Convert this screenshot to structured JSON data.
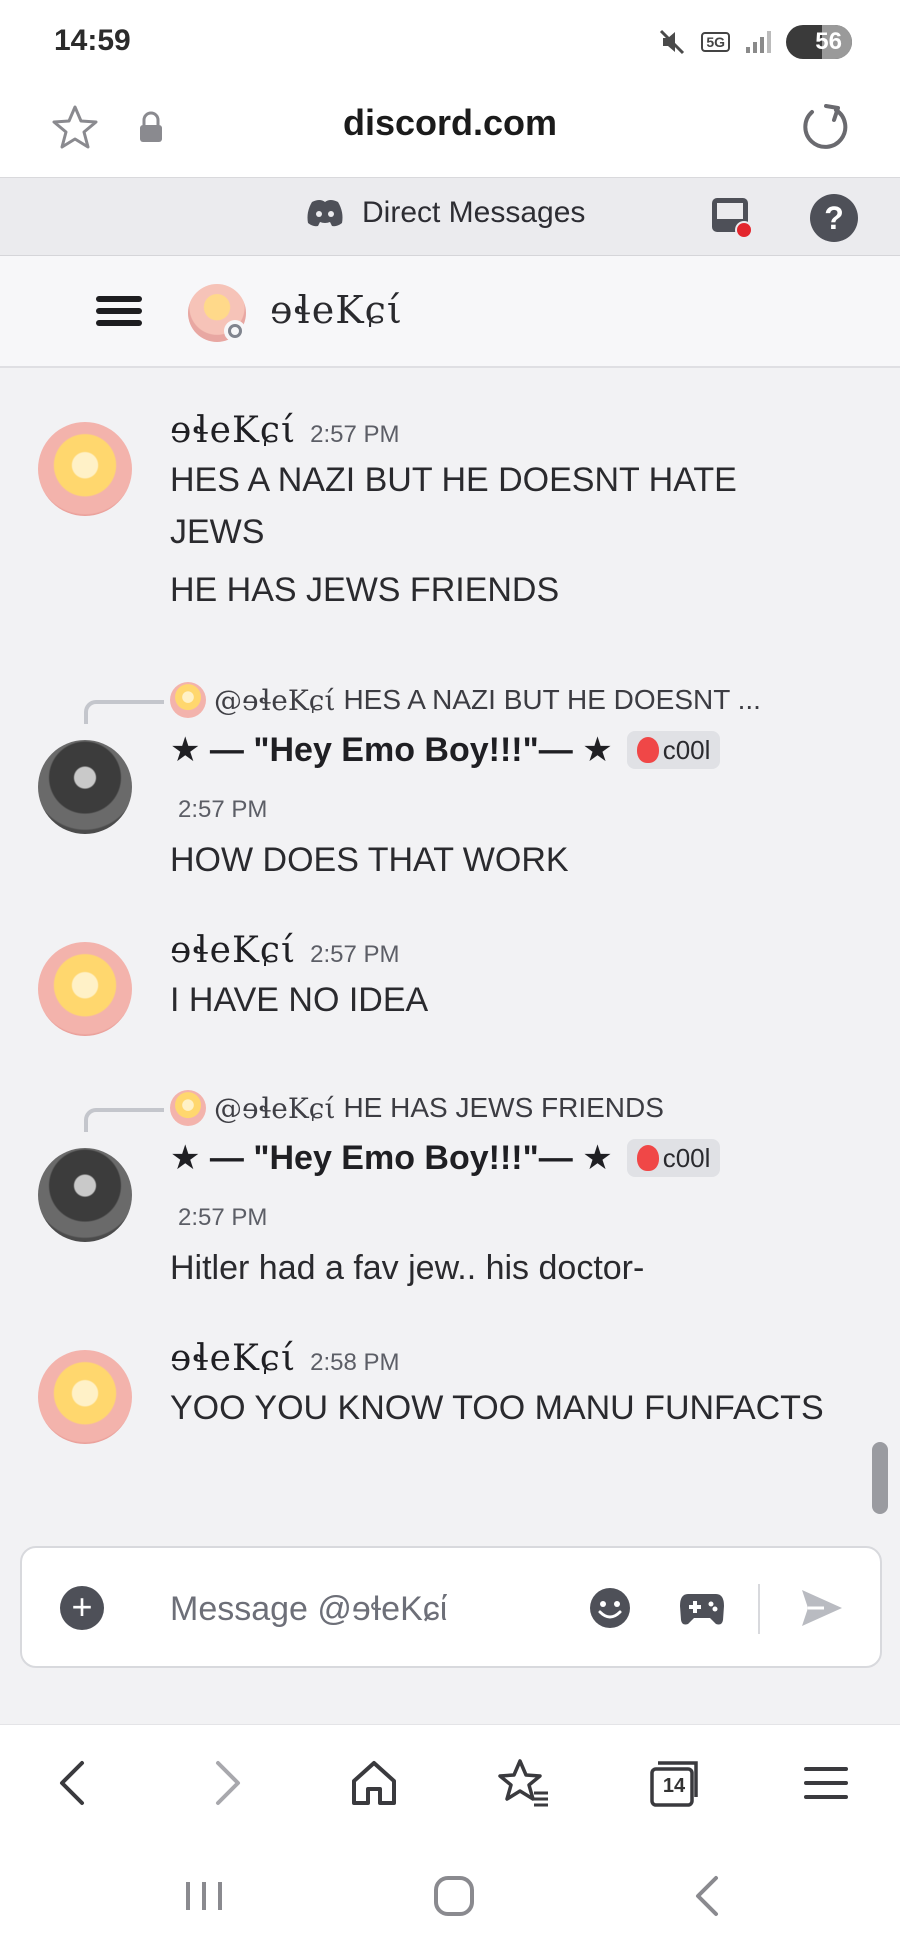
{
  "status_bar": {
    "time": "14:59",
    "network": "5G",
    "battery": "56",
    "icons": [
      "mute-icon",
      "5g-icon",
      "signal-icon",
      "battery-icon"
    ]
  },
  "browser": {
    "url": "discord.com",
    "tabs_count": "14"
  },
  "header": {
    "title": "Direct Messages"
  },
  "channel": {
    "name": "ɘɬeKɕί"
  },
  "messages": [
    {
      "author": "ɘɬeKɕί",
      "time": "2:57 PM",
      "lines": [
        "HES A NAZI BUT HE DOESNT HATE JEWS",
        "HE HAS JEWS FRIENDS"
      ]
    },
    {
      "reply_mention": "@ɘɬeKɕί",
      "reply_text": "HES A NAZI BUT HE DOESNT ...",
      "author": "★ — \"Hey Emo Boy!!!\"— ★",
      "tag": "c00l",
      "time": "2:57 PM",
      "text": "HOW DOES THAT WORK"
    },
    {
      "author": "ɘɬeKɕί",
      "time": "2:57 PM",
      "text": "I HAVE NO IDEA"
    },
    {
      "reply_mention": "@ɘɬeKɕί",
      "reply_text": "HE HAS JEWS FRIENDS",
      "author": "★ — \"Hey Emo Boy!!!\"— ★",
      "tag": "c00l",
      "time": "2:57 PM",
      "text": "Hitler had a fav jew.. his doctor-"
    },
    {
      "author": "ɘɬeKɕί",
      "time": "2:58 PM",
      "text": "YOO YOU KNOW TOO MANU FUNFACTS"
    }
  ],
  "composer": {
    "placeholder": "Message @ɘɬeKɕί"
  },
  "colors": {
    "accent_red": "#f04747",
    "icon_gray": "#4e5058",
    "background": "#f2f2f4"
  }
}
